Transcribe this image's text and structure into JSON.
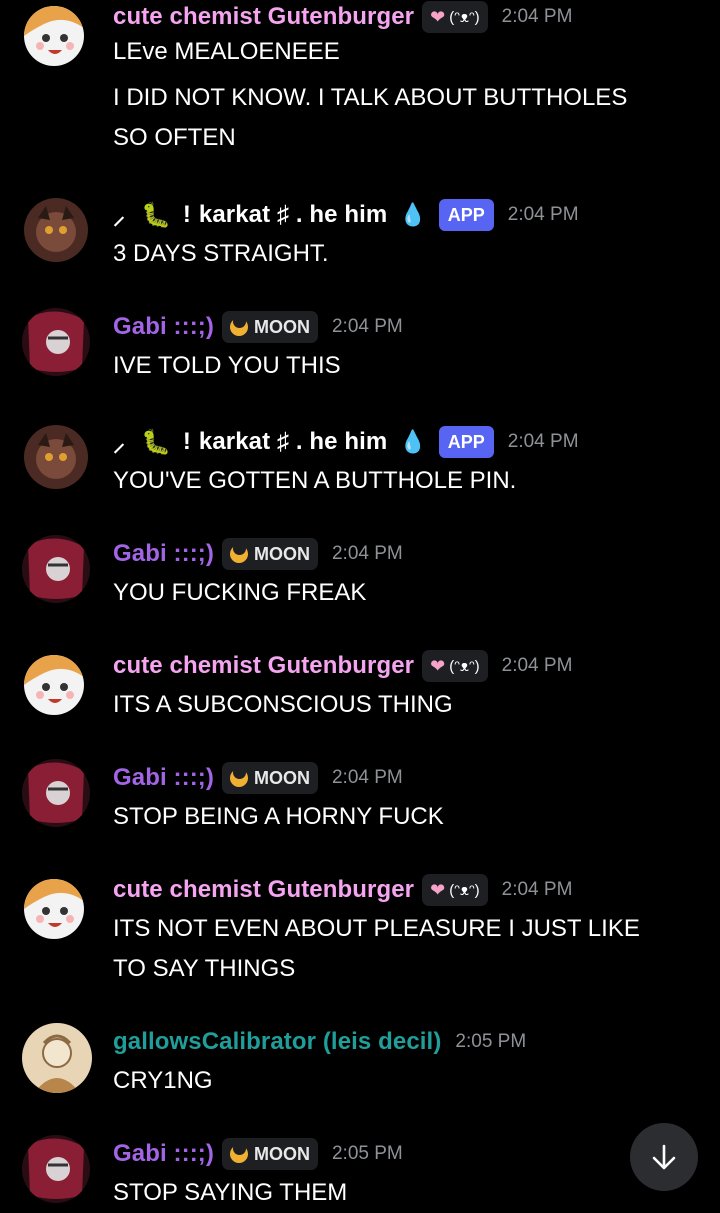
{
  "colors": {
    "pink_user": "#f5a4f0",
    "purple_user": "#a365e6",
    "teal_user": "#1f9e9a",
    "white_user": "#ffffff",
    "app_badge": "#5865f2",
    "timestamp": "#8e9297"
  },
  "roles": {
    "moon": "MOON",
    "app": "APP"
  },
  "messages": [
    {
      "user": "cute chemist Gutenburger",
      "time": "2:04 PM",
      "lines": [
        "LEve MEALOENEEE",
        "I DID NOT KNOW. I TALK ABOUT BUTTHOLES",
        "SO OFTEN"
      ]
    },
    {
      "user_prefix": "⸝ 🐛 !",
      "user": "karkat ♯ . he him",
      "time": "2:04 PM",
      "lines": [
        "3 DAYS STRAIGHT."
      ]
    },
    {
      "user": "Gabi :::;)",
      "time": "2:04 PM",
      "lines": [
        "IVE TOLD YOU THIS"
      ]
    },
    {
      "user_prefix": "⸝ 🐛 !",
      "user": "karkat ♯ . he him",
      "time": "2:04 PM",
      "lines": [
        "YOU'VE GOTTEN A BUTTHOLE PIN."
      ]
    },
    {
      "user": "Gabi :::;)",
      "time": "2:04 PM",
      "lines": [
        "YOU FUCKING FREAK"
      ]
    },
    {
      "user": "cute chemist Gutenburger",
      "time": "2:04 PM",
      "lines": [
        "ITS A SUBCONSCIOUS THING"
      ]
    },
    {
      "user": "Gabi :::;)",
      "time": "2:04 PM",
      "lines": [
        "STOP BEING A HORNY FUCK"
      ]
    },
    {
      "user": "cute chemist Gutenburger",
      "time": "2:04 PM",
      "lines": [
        "ITS NOT EVEN ABOUT PLEASURE I JUST LIKE",
        "TO SAY THINGS"
      ]
    },
    {
      "user": "gallowsCalibrator (leis decil)",
      "time": "2:05 PM",
      "lines": [
        "CRY1NG"
      ]
    },
    {
      "user": "Gabi :::;)",
      "time": "2:05 PM",
      "lines": [
        "STOP SAYING THEM"
      ]
    }
  ]
}
